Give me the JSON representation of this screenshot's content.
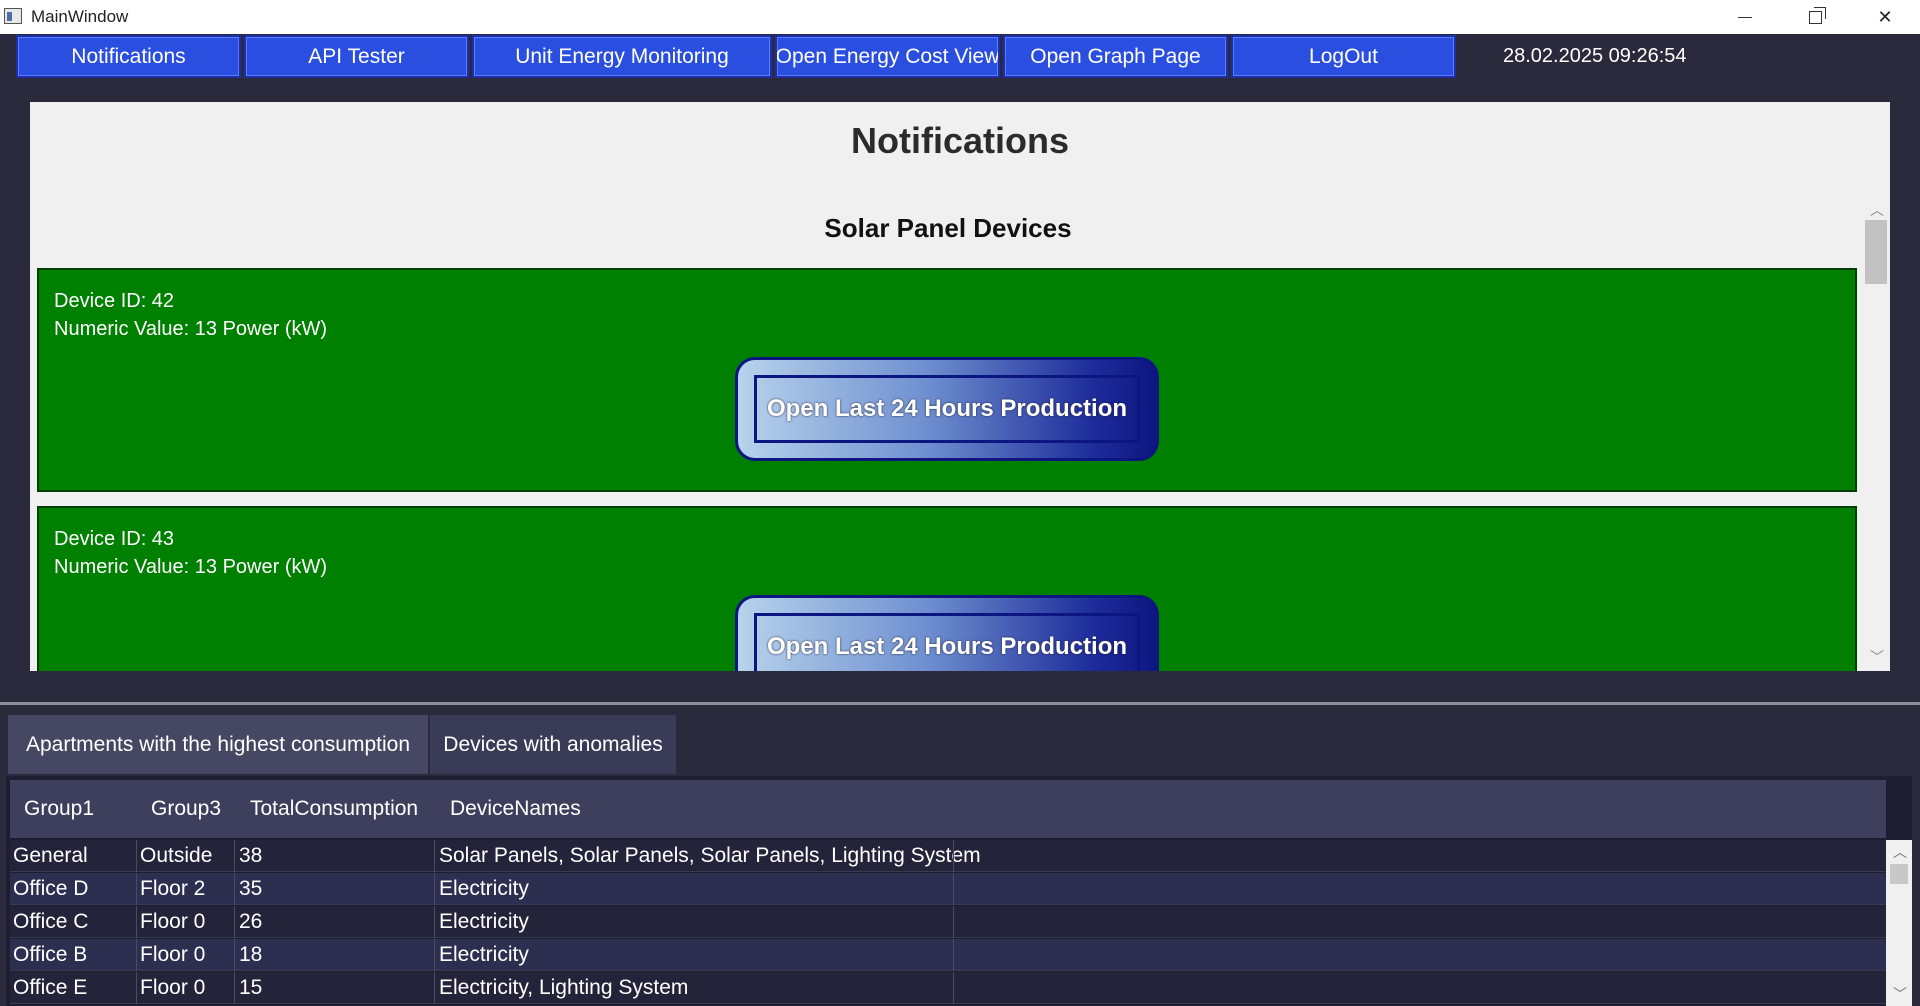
{
  "window": {
    "title": "MainWindow",
    "minimize_icon": "minimize-icon",
    "maximize_icon": "restore-icon",
    "close_icon": "close-icon",
    "close_glyph": "✕"
  },
  "nav": {
    "buttons": [
      {
        "label": "Notifications"
      },
      {
        "label": "API Tester"
      },
      {
        "label": "Unit Energy Monitoring"
      },
      {
        "label": "Open Energy Cost View"
      },
      {
        "label": "Open Graph Page"
      },
      {
        "label": "LogOut"
      }
    ],
    "datetime": "28.02.2025 09:26:54",
    "button_color": "#2a4ee0"
  },
  "notifications": {
    "title": "Notifications",
    "section_title": "Solar Panel Devices",
    "card_color": "#008000",
    "devices": [
      {
        "id_text": "Device ID: 42",
        "value_text": "Numeric Value: 13 Power (kW)",
        "button_label": "Open Last 24 Hours Production"
      },
      {
        "id_text": "Device ID: 43",
        "value_text": "Numeric Value: 13 Power (kW)",
        "button_label": "Open Last 24 Hours Production"
      }
    ],
    "scroll_up_glyph": "︿",
    "scroll_down_glyph": "﹀"
  },
  "tabs": [
    {
      "label": "Apartments with the highest consumption",
      "selected": true
    },
    {
      "label": "Devices with anomalies",
      "selected": false
    }
  ],
  "table": {
    "columns": [
      "Group1",
      "Group3",
      "TotalConsumption",
      "DeviceNames"
    ],
    "rows": [
      [
        "General",
        "Outside",
        "38",
        "Solar Panels, Solar Panels, Solar Panels, Lighting System"
      ],
      [
        "Office D",
        "Floor 2",
        "35",
        "Electricity"
      ],
      [
        "Office C",
        "Floor 0",
        "26",
        "Electricity"
      ],
      [
        "Office B",
        "Floor 0",
        "18",
        "Electricity"
      ],
      [
        "Office E",
        "Floor 0",
        "15",
        "Electricity, Lighting System"
      ]
    ],
    "scroll_up_glyph": "︿",
    "scroll_down_glyph": "﹀"
  }
}
